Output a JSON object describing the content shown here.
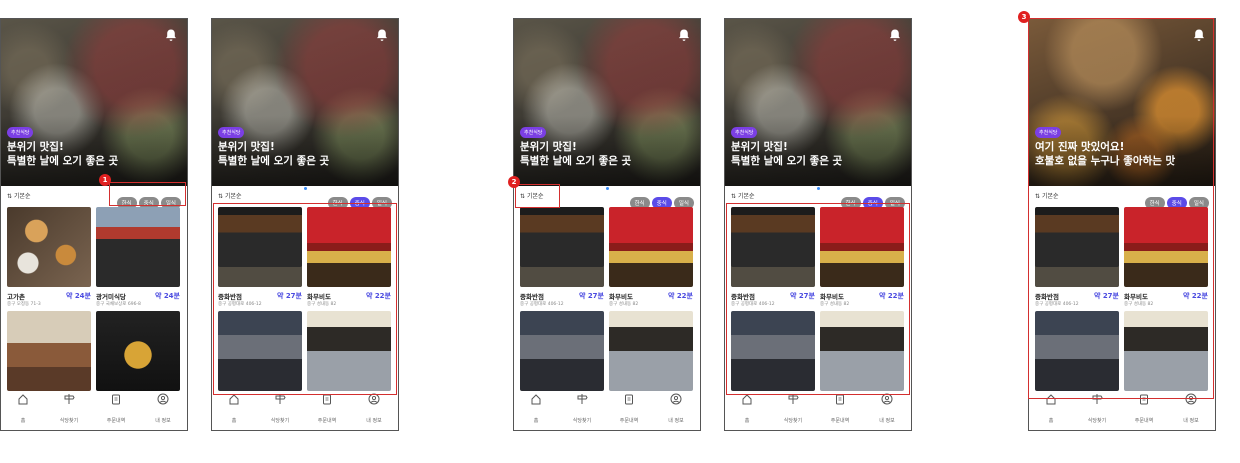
{
  "common": {
    "badge": "추천식당",
    "hero_line1": "분위기 맛집!",
    "hero_line2": "특별한 날에 오기 좋은 곳",
    "sort_label": "기본순",
    "chips": [
      "한식",
      "중식",
      "일식"
    ],
    "tabs": [
      "홈",
      "식당찾기",
      "주문내역",
      "내 정보"
    ]
  },
  "hero_alt": {
    "line1": "여기 진짜 맛있어요!",
    "line2": "호불호 없을 누구나 좋아하는 맛"
  },
  "korean_list": [
    {
      "name": "고가촌",
      "time": "약 24분",
      "addr": "중구 오정동 71-3"
    },
    {
      "name": "광거미식당",
      "time": "약 24분",
      "addr": "중구 국채보상로 696-8"
    }
  ],
  "chinese_list": [
    {
      "name": "중화반점",
      "time": "약 27분",
      "addr": "중구 공평대로 406-12"
    },
    {
      "name": "화무비도",
      "time": "약 22분",
      "addr": "중구 성내동 82"
    }
  ],
  "markers": [
    "1",
    "2",
    "3"
  ],
  "colors": {
    "accent": "#5b4be8",
    "highlight": "#d32f2f",
    "marker": "#e02020",
    "time": "#4a4ae0"
  }
}
